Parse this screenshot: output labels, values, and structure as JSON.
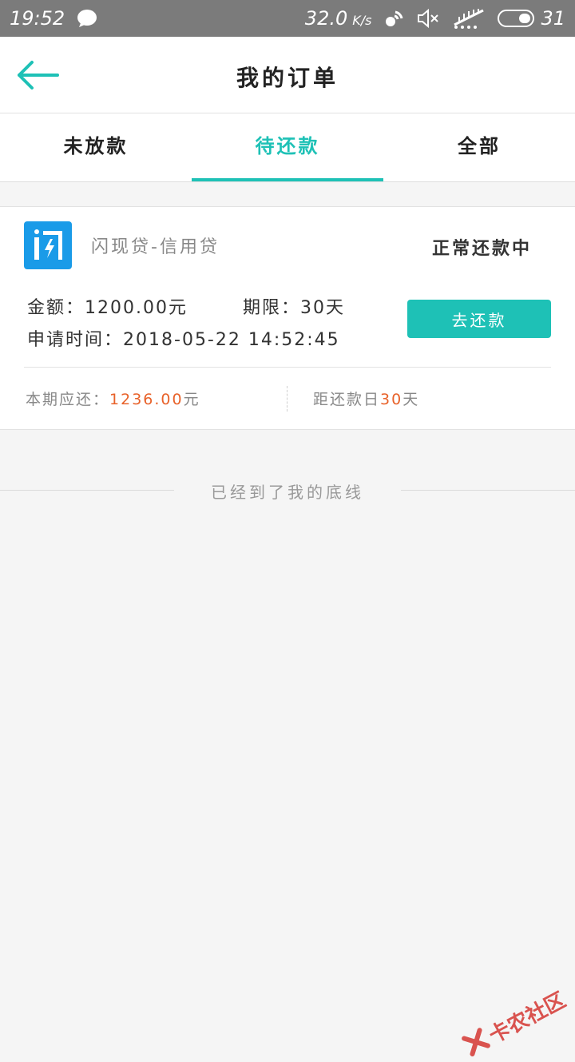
{
  "status_bar": {
    "time": "19:52",
    "speed_value": "32.0",
    "speed_unit": "K/s",
    "battery": "31"
  },
  "header": {
    "title": "我的订单"
  },
  "tabs": [
    {
      "label": "未放款",
      "active": false
    },
    {
      "label": "待还款",
      "active": true
    },
    {
      "label": "全部",
      "active": false
    }
  ],
  "order": {
    "product_name": "闪现贷-信用贷",
    "status": "正常还款中",
    "amount_label": "金额：",
    "amount_value": "1200.00元",
    "term_label": "期限：",
    "term_value": "30天",
    "time_label": "申请时间：",
    "time_value": "2018-05-22 14:52:45",
    "repay_button": "去还款",
    "due_label": "本期应还：",
    "due_amount": "1236.00",
    "due_unit": "元",
    "days_label": "距还款日",
    "days_value": "30",
    "days_unit": "天"
  },
  "list_end": {
    "text": "已经到了我的底线"
  },
  "watermark": {
    "text": "卡农社区"
  },
  "colors": {
    "accent": "#1ec1b6",
    "highlight": "#e8622a",
    "logo": "#1a9be8",
    "status_bar": "#7b7b7b"
  }
}
